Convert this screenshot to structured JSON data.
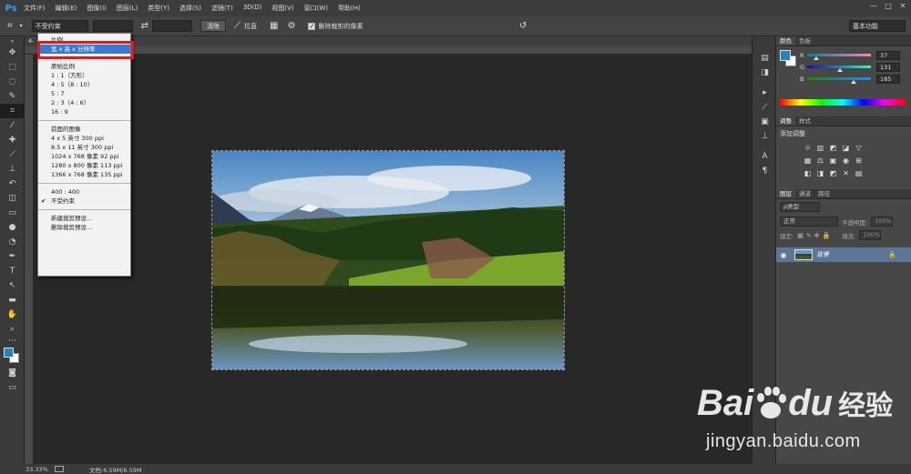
{
  "app": {
    "logo": "Ps"
  },
  "menubar": {
    "items": [
      "文件(F)",
      "编辑(E)",
      "图像(I)",
      "图层(L)",
      "类型(Y)",
      "选择(S)",
      "滤镜(T)",
      "3D(D)",
      "视图(V)",
      "窗口(W)",
      "帮助(H)"
    ],
    "window_controls": [
      "—",
      "□",
      "✕"
    ]
  },
  "options_bar": {
    "ratio_value": "不受约束",
    "clear_label": "清除",
    "straighten_label": "拉直",
    "delete_cropped_label": "删除裁剪的像素",
    "workspace": "基本功能"
  },
  "document": {
    "tab_label": "4-"
  },
  "crop_dropdown": {
    "items": [
      {
        "label": "比例"
      },
      {
        "label": "宽 x 高 x 分辨率",
        "selected": true
      },
      {
        "sep": true
      },
      {
        "label": "原始比例"
      },
      {
        "label": "1 : 1（方形）"
      },
      {
        "label": "4 : 5（8 : 10）"
      },
      {
        "label": "5 : 7"
      },
      {
        "label": "2 : 3（4 : 6）"
      },
      {
        "label": "16 : 9"
      },
      {
        "sep": true
      },
      {
        "label": "前面的图像"
      },
      {
        "label": "4 x 5 英寸 300 ppi"
      },
      {
        "label": "8.5 x 11 英寸 300 ppi"
      },
      {
        "label": "1024 x 768 像素 92 ppi"
      },
      {
        "label": "1280 x 800 像素 113 ppi"
      },
      {
        "label": "1366 x 768 像素 135 ppi"
      },
      {
        "sep": true
      },
      {
        "label": "400 : 400"
      },
      {
        "label": "不受约束",
        "checked": true
      },
      {
        "sep": true
      },
      {
        "label": "新建裁剪预设..."
      },
      {
        "label": "删除裁剪预设..."
      }
    ]
  },
  "color_panel": {
    "tabs": [
      "颜色",
      "色板"
    ],
    "channels": [
      {
        "label": "R",
        "value": "37",
        "fraction": 0.145,
        "gradient": "linear-gradient(to right,#00839a,#ff83b9)"
      },
      {
        "label": "G",
        "value": "131",
        "fraction": 0.514,
        "gradient": "linear-gradient(to right,#2500b9,#25ffb9)"
      },
      {
        "label": "B",
        "value": "185",
        "fraction": 0.725,
        "gradient": "linear-gradient(to right,#258300,#2583ff)"
      }
    ],
    "foreground": "#2583b9",
    "background": "#ffffff"
  },
  "adjust_panel": {
    "tabs": [
      "调整",
      "样式"
    ],
    "title": "添加调整",
    "row1": [
      "☼",
      "▥",
      "◩",
      "◪",
      "▽"
    ],
    "row2": [
      "▦",
      "⚖",
      "▣",
      "◉",
      "⊞"
    ],
    "row3": [
      "◧",
      "◨",
      "◩",
      "✕",
      "▤"
    ]
  },
  "layers_panel": {
    "tabs": [
      "图层",
      "通道",
      "路径"
    ],
    "kind_filter": "ρ类型",
    "blend_mode": "正常",
    "opacity_label": "不透明度:",
    "opacity_value": "100%",
    "lock_label": "锁定:",
    "fill_label": "填充:",
    "fill_value": "100%",
    "layers": [
      {
        "name": "背景",
        "visible": true,
        "locked": true
      }
    ]
  },
  "status_bar": {
    "zoom": "33.33%",
    "doc_info": "文档:6.59M/6.59M"
  },
  "watermark": {
    "brand": "Bai",
    "brand2": "du",
    "cn": "经验",
    "url": "jingyan.baidu.com"
  }
}
